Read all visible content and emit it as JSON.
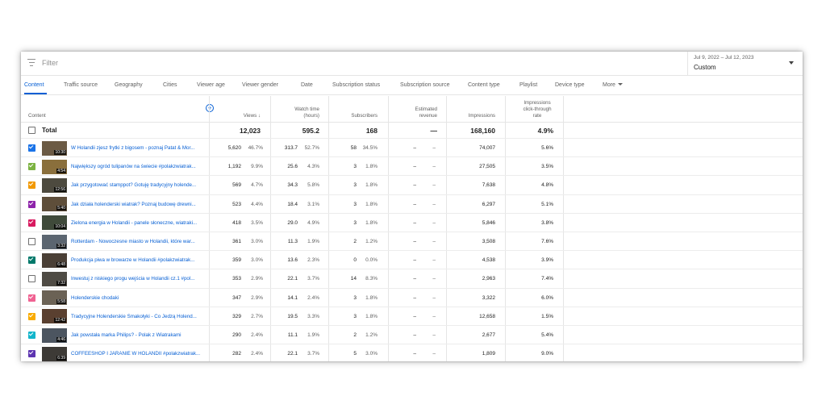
{
  "filter": {
    "placeholder": "Filter",
    "icon": "filter-icon"
  },
  "date": {
    "range": "Jul 9, 2022 – Jul 12, 2023",
    "preset": "Custom"
  },
  "tabs": [
    "Content",
    "Traffic source",
    "Geography",
    "Cities",
    "Viewer age",
    "Viewer gender",
    "Date",
    "Subscription status",
    "Subscription source",
    "Content type",
    "Playlist",
    "Device type",
    "More"
  ],
  "columns": {
    "content": "Content",
    "views": "Views",
    "watch_time": [
      "Watch time",
      "(hours)"
    ],
    "subscribers": "Subscribers",
    "revenue": [
      "Estimated",
      "revenue"
    ],
    "impressions": "Impressions",
    "ctr": [
      "Impressions",
      "click-through",
      "rate"
    ]
  },
  "total": {
    "label": "Total",
    "views": "12,023",
    "watch_time": "595.2",
    "subscribers": "168",
    "revenue": "—",
    "impressions": "168,160",
    "ctr": "4.9%"
  },
  "rows": [
    {
      "checked": true,
      "color": "#1a73e8",
      "duration": "10:30",
      "title": "W Holandii zjesz frytki z bigosem - poznaj Patat & Mor...",
      "views": "5,620",
      "views_pct": "46.7%",
      "wt": "313.7",
      "wt_pct": "52.7%",
      "subs": "58",
      "subs_pct": "34.5%",
      "rev": "–",
      "rev_pct": "–",
      "impr": "74,007",
      "ctr": "5.6%"
    },
    {
      "checked": true,
      "color": "#7cb342",
      "duration": "4:54",
      "title": "Największy ogród tulipanów na świecie #polakzwiatrak...",
      "views": "1,192",
      "views_pct": "9.9%",
      "wt": "25.6",
      "wt_pct": "4.3%",
      "subs": "3",
      "subs_pct": "1.8%",
      "rev": "–",
      "rev_pct": "–",
      "impr": "27,505",
      "ctr": "3.5%"
    },
    {
      "checked": true,
      "color": "#f29900",
      "duration": "12:56",
      "title": "Jak przygotować stamppot? Gotuję tradycyjny holende...",
      "views": "569",
      "views_pct": "4.7%",
      "wt": "34.3",
      "wt_pct": "5.8%",
      "subs": "3",
      "subs_pct": "1.8%",
      "rev": "–",
      "rev_pct": "–",
      "impr": "7,638",
      "ctr": "4.8%"
    },
    {
      "checked": true,
      "color": "#8e24aa",
      "duration": "5:40",
      "title": "Jak działa holenderski wiatrak? Poznaj budowę drewni...",
      "views": "523",
      "views_pct": "4.4%",
      "wt": "18.4",
      "wt_pct": "3.1%",
      "subs": "3",
      "subs_pct": "1.8%",
      "rev": "–",
      "rev_pct": "–",
      "impr": "6,297",
      "ctr": "5.1%"
    },
    {
      "checked": true,
      "color": "#d81b60",
      "duration": "10:04",
      "title": "Zielona energia w Holandii - panele słoneczne, wiatraki...",
      "views": "418",
      "views_pct": "3.5%",
      "wt": "29.0",
      "wt_pct": "4.9%",
      "subs": "3",
      "subs_pct": "1.8%",
      "rev": "–",
      "rev_pct": "–",
      "impr": "5,846",
      "ctr": "3.8%"
    },
    {
      "checked": false,
      "color": "#707070",
      "duration": "3:32",
      "title": "Rotterdam - Nowoczesne miasto w Holandii, które war...",
      "views": "361",
      "views_pct": "3.0%",
      "wt": "11.3",
      "wt_pct": "1.9%",
      "subs": "2",
      "subs_pct": "1.2%",
      "rev": "–",
      "rev_pct": "–",
      "impr": "3,508",
      "ctr": "7.6%"
    },
    {
      "checked": true,
      "color": "#00796b",
      "duration": "6:48",
      "title": "Produkcja piwa w browarze w Holandii #polakzwiatrak...",
      "views": "359",
      "views_pct": "3.0%",
      "wt": "13.6",
      "wt_pct": "2.3%",
      "subs": "0",
      "subs_pct": "0.0%",
      "rev": "–",
      "rev_pct": "–",
      "impr": "4,538",
      "ctr": "3.9%"
    },
    {
      "checked": false,
      "color": "#707070",
      "duration": "7:32",
      "title": "Inwestuj z niskiego progu wejścia w Holandii cz.1 #pol...",
      "views": "353",
      "views_pct": "2.9%",
      "wt": "22.1",
      "wt_pct": "3.7%",
      "subs": "14",
      "subs_pct": "8.3%",
      "rev": "–",
      "rev_pct": "–",
      "impr": "2,963",
      "ctr": "7.4%"
    },
    {
      "checked": true,
      "color": "#f06292",
      "duration": "5:58",
      "title": "Holenderskie chodaki",
      "views": "347",
      "views_pct": "2.9%",
      "wt": "14.1",
      "wt_pct": "2.4%",
      "subs": "3",
      "subs_pct": "1.8%",
      "rev": "–",
      "rev_pct": "–",
      "impr": "3,322",
      "ctr": "6.0%"
    },
    {
      "checked": true,
      "color": "#f9ab00",
      "duration": "12:42",
      "title": "Tradycyjne Holenderskie Smakołyki - Co Jedzą Holend...",
      "views": "329",
      "views_pct": "2.7%",
      "wt": "19.5",
      "wt_pct": "3.3%",
      "subs": "3",
      "subs_pct": "1.8%",
      "rev": "–",
      "rev_pct": "–",
      "impr": "12,658",
      "ctr": "1.5%"
    },
    {
      "checked": true,
      "color": "#12b5cb",
      "duration": "4:46",
      "title": "Jak powstała marka Philips? - Polak z Wiatrakami",
      "views": "290",
      "views_pct": "2.4%",
      "wt": "11.1",
      "wt_pct": "1.9%",
      "subs": "2",
      "subs_pct": "1.2%",
      "rev": "–",
      "rev_pct": "–",
      "impr": "2,677",
      "ctr": "5.4%"
    },
    {
      "checked": true,
      "color": "#5e35b1",
      "duration": "6:39",
      "title": "COFFEESHOP I JARANIE W HOLANDII #polakzwiatrak...",
      "views": "282",
      "views_pct": "2.4%",
      "wt": "22.1",
      "wt_pct": "3.7%",
      "subs": "5",
      "subs_pct": "3.0%",
      "rev": "–",
      "rev_pct": "–",
      "impr": "1,809",
      "ctr": "9.0%"
    }
  ]
}
